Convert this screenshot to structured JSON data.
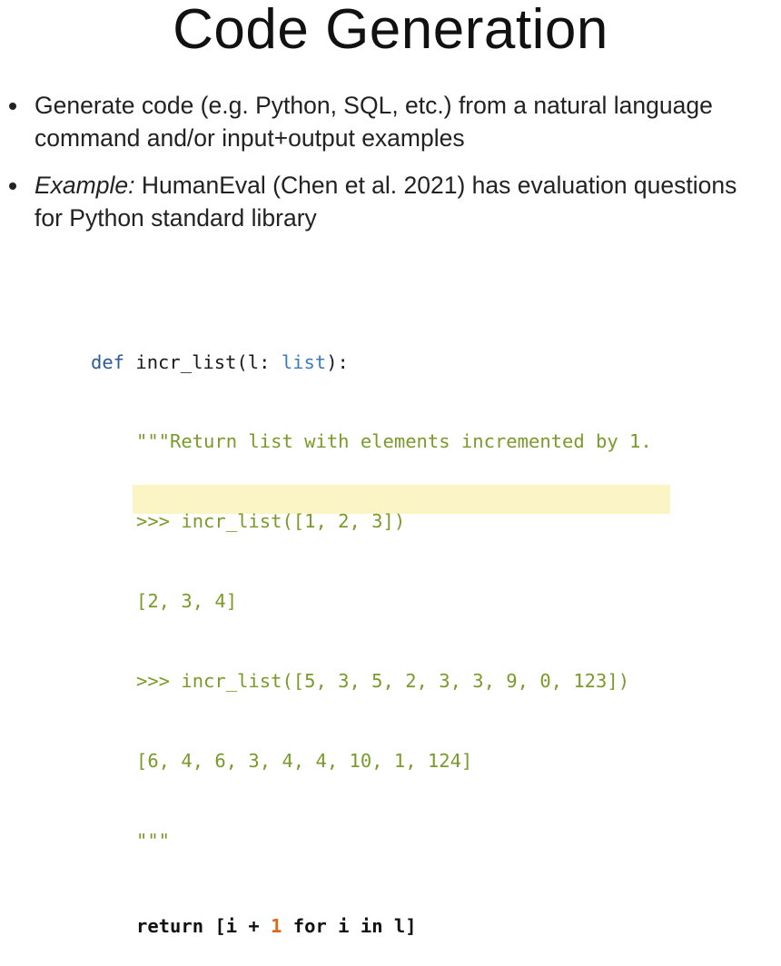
{
  "slide": {
    "title": "Code Generation",
    "bullets": [
      {
        "lead": "",
        "text": "Generate code (e.g. Python, SQL, etc.) from a natural language command and/or input+output examples"
      },
      {
        "lead": "Example:",
        "text": " HumanEval (Chen et al. 2021) has evaluation questions for Python standard library"
      }
    ]
  },
  "code": {
    "def_kw": "def",
    "func_name": "incr_list",
    "param": "(l: ",
    "param_type": "list",
    "sig_end": "):",
    "doc_lines": [
      "\"\"\"Return list with elements incremented by 1.",
      ">>> incr_list([1, 2, 3])",
      "[2, 3, 4]",
      ">>> incr_list([5, 3, 5, 2, 3, 3, 9, 0, 123])",
      "[6, 4, 6, 3, 4, 4, 10, 1, 124]",
      "\"\"\""
    ],
    "return_pre": "return [i + ",
    "return_num": "1",
    "return_post": " for i in l]",
    "highlight_color": "#fbf5c6"
  }
}
